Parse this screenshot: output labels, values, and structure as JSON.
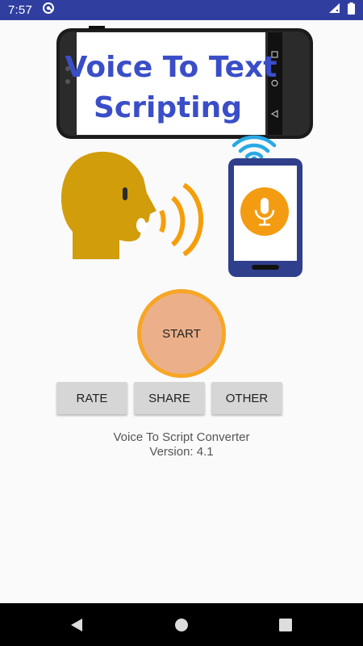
{
  "status_bar": {
    "time": "7:57",
    "bg_color": "#303f9f",
    "left_icons": [
      "vpn-key-icon"
    ],
    "right_icons": [
      "signal-icon",
      "battery-icon"
    ]
  },
  "hero": {
    "title_line1": "Voice To Text",
    "title_line2": "Scripting",
    "title_color": "#3a4ec8",
    "graphics": [
      "phone-landscape-image",
      "speaking-head-icon",
      "sound-waves-icon",
      "wifi-icon",
      "phone-microphone-icon"
    ]
  },
  "start_button": {
    "label": "START",
    "fill_color": "#ebb08a",
    "ring_color": "#f7a625"
  },
  "buttons": {
    "rate": "RATE",
    "share": "SHARE",
    "other": "OTHER"
  },
  "app_info": {
    "name": "Voice To Script Converter",
    "version": "Version: 4.1"
  },
  "nav_bar": {
    "icons": [
      "back-icon",
      "home-icon",
      "recents-icon"
    ]
  }
}
